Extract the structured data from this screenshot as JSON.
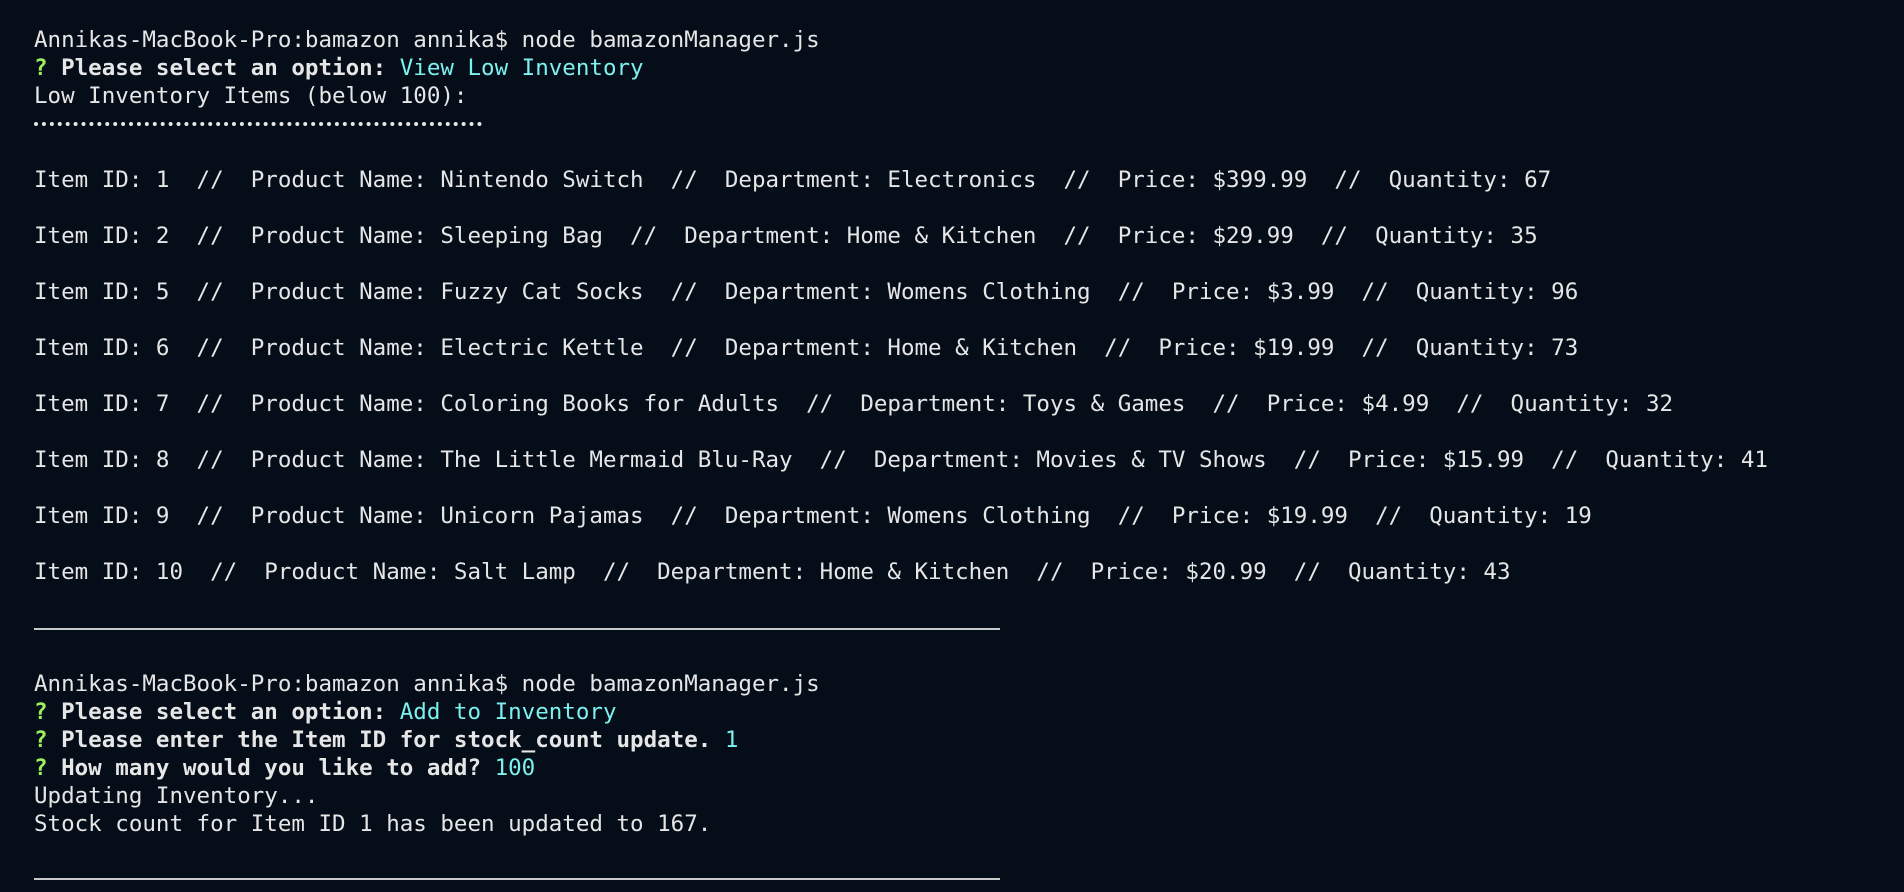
{
  "session1": {
    "prompt": "Annikas-MacBook-Pro:bamazon annika$ node bamazonManager.js",
    "option_mark": "?",
    "option_question": "Please select an option:",
    "option_answer": "View Low Inventory",
    "heading": "Low Inventory Items (below 100):"
  },
  "items": [
    "Item ID: 1  //  Product Name: Nintendo Switch  //  Department: Electronics  //  Price: $399.99  //  Quantity: 67",
    "Item ID: 2  //  Product Name: Sleeping Bag  //  Department: Home & Kitchen  //  Price: $29.99  //  Quantity: 35",
    "Item ID: 5  //  Product Name: Fuzzy Cat Socks  //  Department: Womens Clothing  //  Price: $3.99  //  Quantity: 96",
    "Item ID: 6  //  Product Name: Electric Kettle  //  Department: Home & Kitchen  //  Price: $19.99  //  Quantity: 73",
    "Item ID: 7  //  Product Name: Coloring Books for Adults  //  Department: Toys & Games  //  Price: $4.99  //  Quantity: 32",
    "Item ID: 8  //  Product Name: The Little Mermaid Blu-Ray  //  Department: Movies & TV Shows  //  Price: $15.99  //  Quantity: 41",
    "Item ID: 9  //  Product Name: Unicorn Pajamas  //  Department: Womens Clothing  //  Price: $19.99  //  Quantity: 19",
    "Item ID: 10  //  Product Name: Salt Lamp  //  Department: Home & Kitchen  //  Price: $20.99  //  Quantity: 43"
  ],
  "session2": {
    "prompt": "Annikas-MacBook-Pro:bamazon annika$ node bamazonManager.js",
    "q1_mark": "?",
    "q1_question": "Please select an option:",
    "q1_answer": "Add to Inventory",
    "q2_mark": "?",
    "q2_question": "Please enter the Item ID for stock_count update.",
    "q2_answer": "1",
    "q3_mark": "?",
    "q3_question": "How many would you like to add?",
    "q3_answer": "100",
    "status1": "Updating Inventory...",
    "status2": "Stock count for Item ID 1 has been updated to 167."
  },
  "colors": {
    "background": "#040d18",
    "text": "#e6e6e6",
    "question_mark": "#9ef05c",
    "answer": "#7df0f0"
  }
}
